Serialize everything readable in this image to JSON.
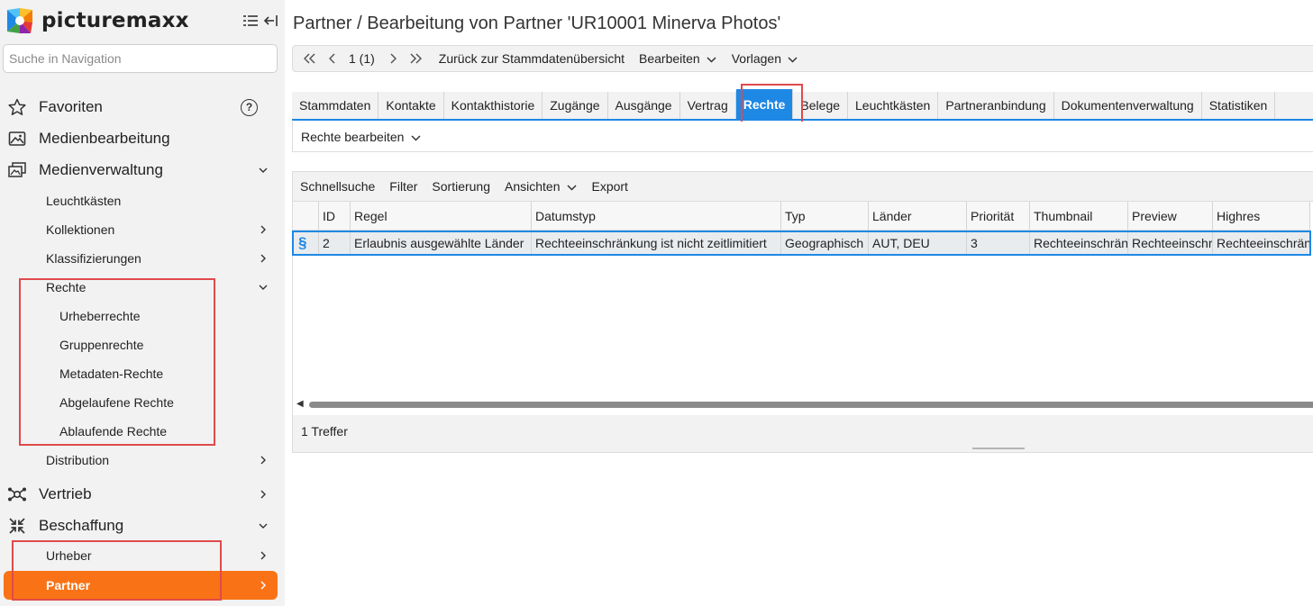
{
  "app": {
    "logo_text": "picturemaxx",
    "search_placeholder": "Suche in Navigation"
  },
  "sidebar": {
    "favoriten": "Favoriten",
    "help_glyph": "?",
    "medienbearbeitung": "Medienbearbeitung",
    "medienverwaltung": "Medienverwaltung",
    "leuchtkaesten": "Leuchtkästen",
    "kollektionen": "Kollektionen",
    "klassifizierungen": "Klassifizierungen",
    "rechte": "Rechte",
    "urheberrechte": "Urheberrechte",
    "gruppenrechte": "Gruppenrechte",
    "metadaten_rechte": "Metadaten-Rechte",
    "abgelaufene_rechte": "Abgelaufene Rechte",
    "ablaufende_rechte": "Ablaufende Rechte",
    "distribution": "Distribution",
    "vertrieb": "Vertrieb",
    "beschaffung": "Beschaffung",
    "urheber": "Urheber",
    "partner": "Partner"
  },
  "main": {
    "title": "Partner / Bearbeitung von Partner 'UR10001 Minerva Photos'",
    "toolbar": {
      "page_indicator": "1 (1)",
      "back_label": "Zurück zur Stammdatenübersicht",
      "edit_label": "Bearbeiten",
      "templates_label": "Vorlagen"
    },
    "tabs": [
      "Stammdaten",
      "Kontakte",
      "Kontakthistorie",
      "Zugänge",
      "Ausgänge",
      "Vertrag",
      "Rechte",
      "Belege",
      "Leuchtkästen",
      "Partneranbindung",
      "Dokumentenverwaltung",
      "Statistiken"
    ],
    "active_tab": "Rechte",
    "subbar_label": "Rechte bearbeiten",
    "grid": {
      "toolbar": {
        "quicksearch": "Schnellsuche",
        "filter": "Filter",
        "sort": "Sortierung",
        "views": "Ansichten",
        "export": "Export"
      },
      "columns": [
        "",
        "ID",
        "Regel",
        "Datumstyp",
        "Typ",
        "Länder",
        "Priorität",
        "Thumbnail",
        "Preview",
        "Highres"
      ],
      "rows": [
        [
          "§",
          "2",
          "Erlaubnis ausgewählte Länder",
          "Rechteeinschränkung ist nicht zeitlimitiert",
          "Geographisch",
          "AUT, DEU",
          "3",
          "Rechteeinschränkung",
          "Rechteeinschränkung",
          "Rechteeinschränkung"
        ]
      ],
      "footer": "1 Treffer"
    }
  },
  "colors": {
    "accent": "#1e88e5",
    "active_nav": "#f97316",
    "highlight": "#e04a4a"
  }
}
